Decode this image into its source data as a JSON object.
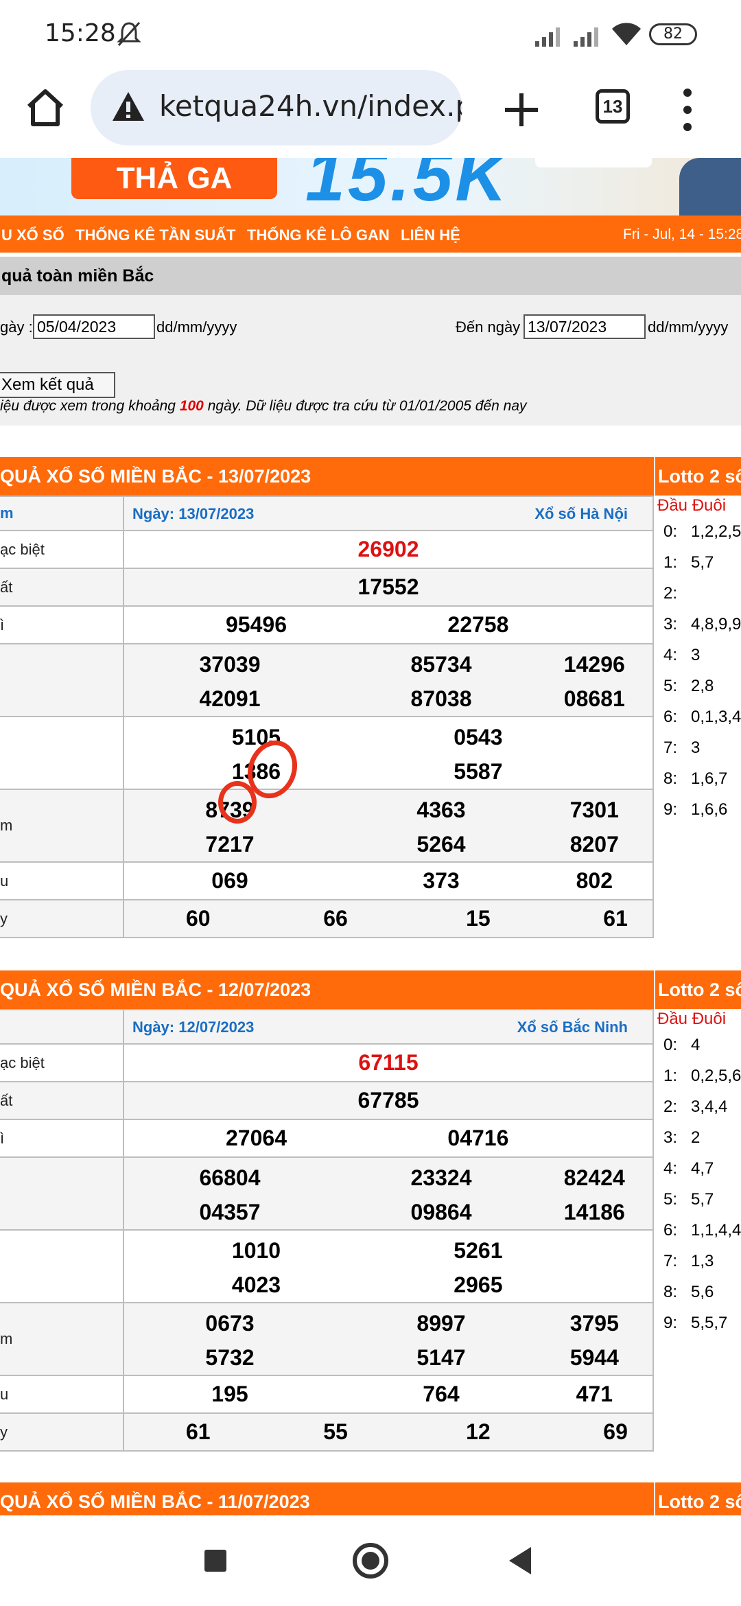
{
  "status": {
    "time": "15:28",
    "battery": "82"
  },
  "browser": {
    "url": "ketqua24h.vn/index.p",
    "tab_count": "13"
  },
  "banner": {
    "pill_text": "THẢ GA",
    "big_text": "15.5K"
  },
  "nav": {
    "items": [
      "U XỔ SỐ",
      "THỐNG KÊ TẦN SUẤT",
      "THỐNG KÊ LÔ GAN",
      "LIÊN HỆ"
    ],
    "date": "Fri - Jul, 14 - 15:28"
  },
  "search": {
    "title": "quả toàn miền Bắc",
    "from_label": "gày :",
    "from_value": "05/04/2023",
    "fmt1": "dd/mm/yyyy",
    "to_label": "Đến ngày :",
    "to_value": "13/07/2023",
    "fmt2": "dd/mm/yyyy",
    "button": "Xem kết quả",
    "note_pre": "iệu được xem trong khoảng ",
    "note_num": "100",
    "note_post": " ngày. Dữ liệu được tra cứu từ 01/01/2005 đến nay"
  },
  "blocks": [
    {
      "title": "QUẢ XỔ SỐ MIỀN BẮC - 13/07/2023",
      "lotto_title": "Lotto 2 số",
      "hdr_left": "m",
      "hdr_date": "Ngày: 13/07/2023",
      "hdr_region": "Xổ số Hà Nội",
      "labels": [
        "ạc biệt",
        "ất",
        "ì",
        "",
        "",
        "m",
        "u",
        "y"
      ],
      "special": "26902",
      "g1": "17552",
      "g2": [
        "95496",
        "22758"
      ],
      "g3": [
        "37039",
        "85734",
        "14296",
        "42091",
        "87038",
        "08681"
      ],
      "g4": [
        "5105",
        "0543",
        "1386",
        "5587"
      ],
      "g5": [
        "8739",
        "4363",
        "7301",
        "7217",
        "5264",
        "8207"
      ],
      "g6": [
        "069",
        "373",
        "802"
      ],
      "g7": [
        "60",
        "66",
        "15",
        "61"
      ],
      "lotto_head": "Đầu Đuôi",
      "lotto": [
        [
          "0:",
          "1,2,2,5"
        ],
        [
          "1:",
          "5,7"
        ],
        [
          "2:",
          ""
        ],
        [
          "3:",
          "4,8,9,9"
        ],
        [
          "4:",
          "3"
        ],
        [
          "5:",
          "2,8"
        ],
        [
          "6:",
          "0,1,3,4"
        ],
        [
          "7:",
          "3"
        ],
        [
          "8:",
          "1,6,7"
        ],
        [
          "9:",
          "1,6,6"
        ]
      ]
    },
    {
      "title": "QUẢ XỔ SỐ MIỀN BẮC - 12/07/2023",
      "lotto_title": "Lotto 2 số",
      "hdr_left": "",
      "hdr_date": "Ngày: 12/07/2023",
      "hdr_region": "Xổ số Bắc Ninh",
      "labels": [
        "ạc biệt",
        "ất",
        "ì",
        "",
        "",
        "m",
        "u",
        "y"
      ],
      "special": "67115",
      "g1": "67785",
      "g2": [
        "27064",
        "04716"
      ],
      "g3": [
        "66804",
        "23324",
        "82424",
        "04357",
        "09864",
        "14186"
      ],
      "g4": [
        "1010",
        "5261",
        "4023",
        "2965"
      ],
      "g5": [
        "0673",
        "8997",
        "3795",
        "5732",
        "5147",
        "5944"
      ],
      "g6": [
        "195",
        "764",
        "471"
      ],
      "g7": [
        "61",
        "55",
        "12",
        "69"
      ],
      "lotto_head": "Đầu Đuôi",
      "lotto": [
        [
          "0:",
          "4"
        ],
        [
          "1:",
          "0,2,5,6"
        ],
        [
          "2:",
          "3,4,4"
        ],
        [
          "3:",
          "2"
        ],
        [
          "4:",
          "4,7"
        ],
        [
          "5:",
          "5,7"
        ],
        [
          "6:",
          "1,1,4,4"
        ],
        [
          "7:",
          "1,3"
        ],
        [
          "8:",
          "5,6"
        ],
        [
          "9:",
          "5,5,7"
        ]
      ]
    },
    {
      "title": "QUẢ XỔ SỐ MIỀN BẮC - 11/07/2023",
      "lotto_title": "Lotto 2 số"
    }
  ]
}
